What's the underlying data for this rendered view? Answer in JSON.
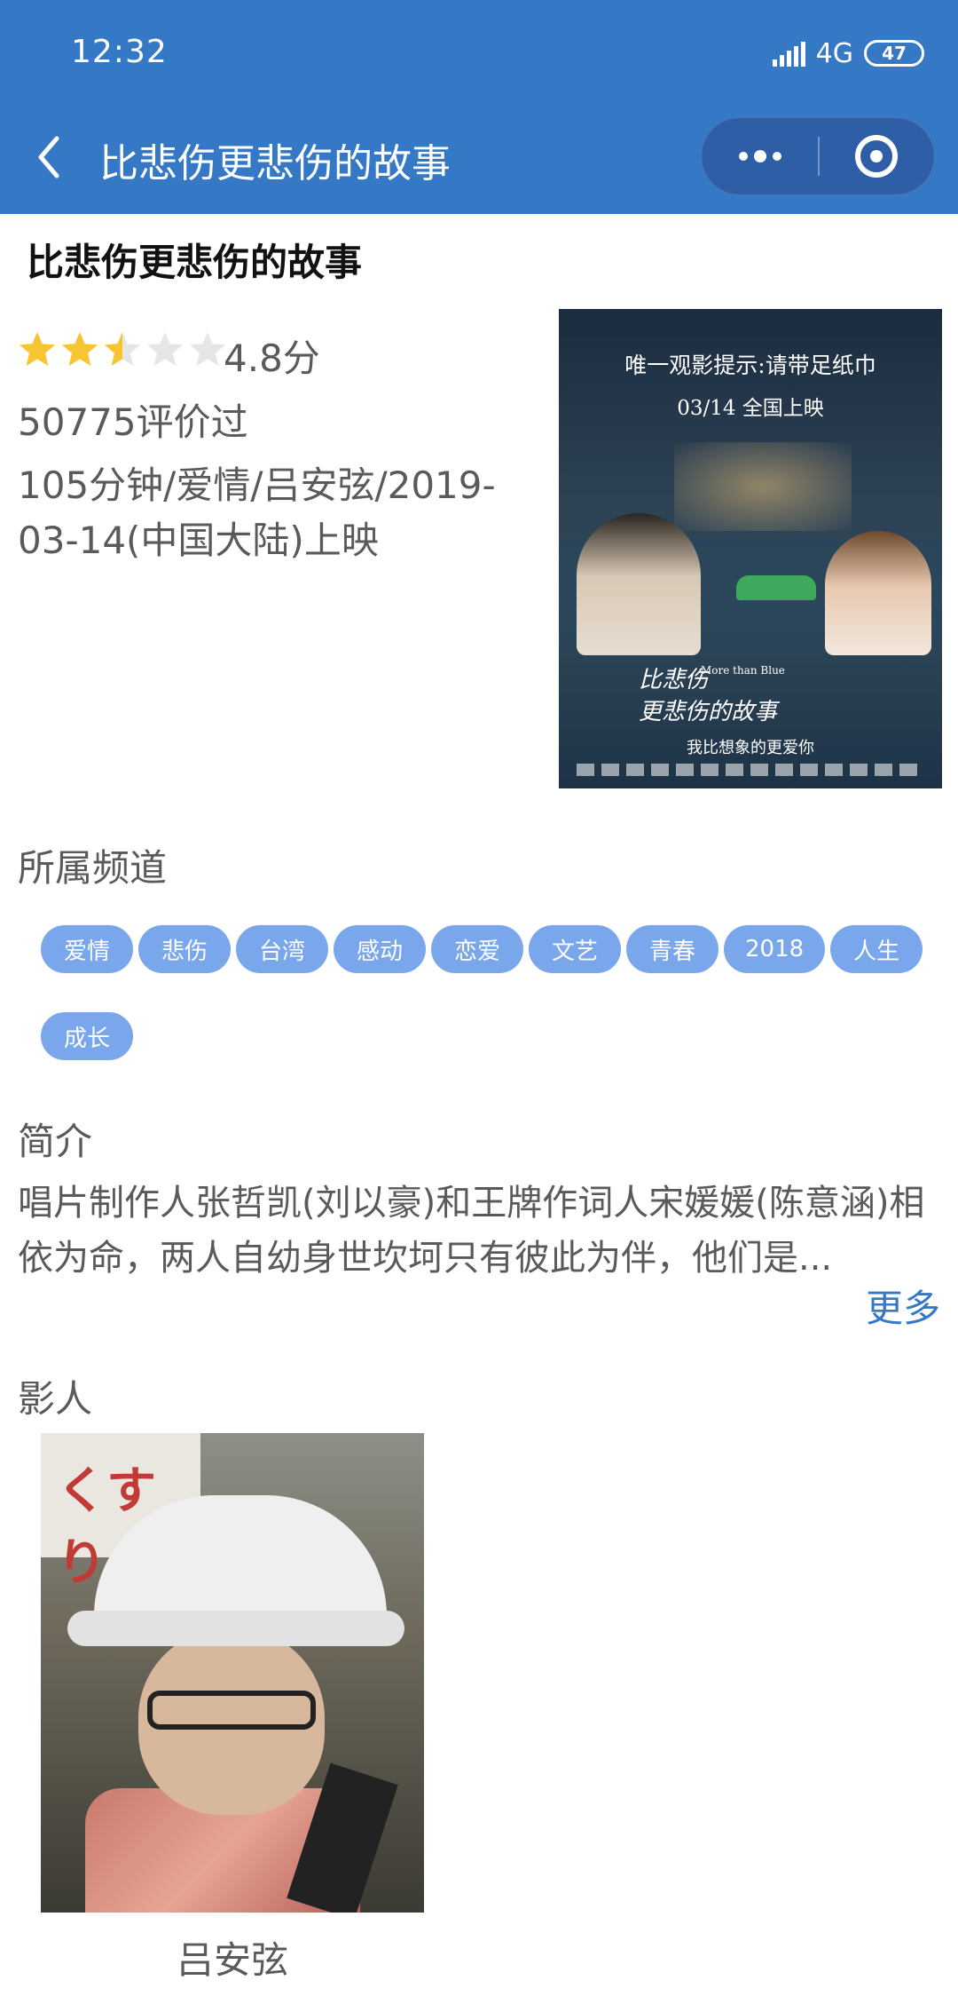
{
  "status_bar": {
    "time": "12:32",
    "network": "4G",
    "battery": "47"
  },
  "nav": {
    "title": "比悲伤更悲伤的故事"
  },
  "movie": {
    "title": "比悲伤更悲伤的故事",
    "rating": {
      "stars_filled": 2.5,
      "stars_total": 5,
      "score": "4.8分"
    },
    "rating_count": "50775评价过",
    "meta": "105分钟/爱情/吕安弦/2019-03-14(中国大陆)上映",
    "poster": {
      "top_line": "唯一观影提示:请带足纸巾",
      "release_line": "03/14 全国上映",
      "handwriting": "比悲伤\n更悲伤的故事",
      "english": "More than Blue",
      "tagline": "我比想象的更爱你"
    }
  },
  "channels": {
    "label": "所属频道",
    "tags": [
      "爱情",
      "悲伤",
      "台湾",
      "感动",
      "恋爱",
      "文艺",
      "青春",
      "2018",
      "人生",
      "成长"
    ]
  },
  "intro": {
    "label": "简介",
    "text": "唱片制作人张哲凯(刘以豪)和王牌作词人宋媛媛(陈意涵)相依为命，两人自幼身世坎坷只有彼此为伴，他们是...",
    "more": "更多"
  },
  "cast": {
    "label": "影人",
    "people": [
      {
        "name": "吕安弦",
        "photo_sign_text": "くすり"
      }
    ]
  },
  "colors": {
    "header_bg": "#3478c6",
    "tag_bg": "#7aa7eb",
    "star_filled": "#f7c531",
    "star_empty": "#e6e6e6",
    "link": "#3478c6"
  }
}
